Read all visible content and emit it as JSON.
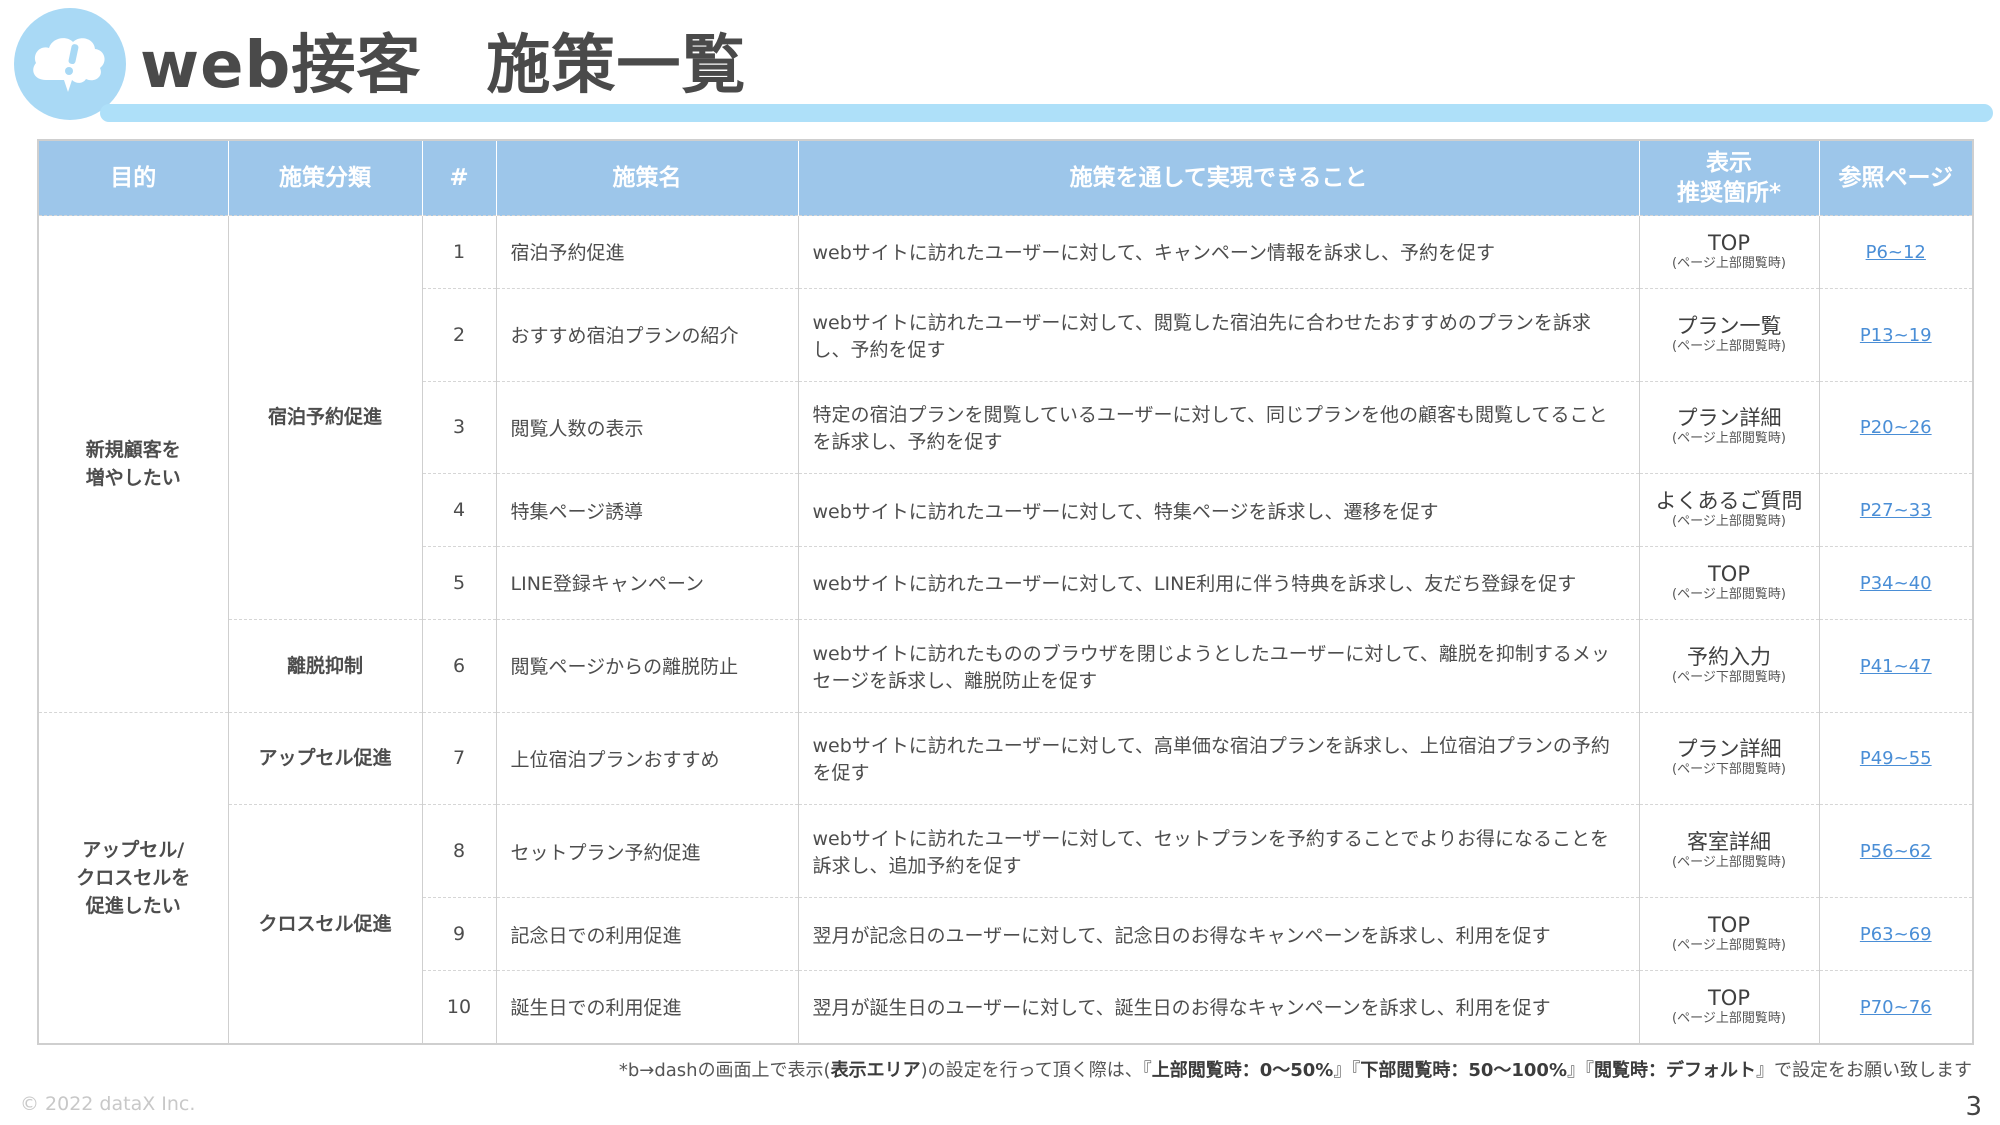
{
  "header": {
    "title": "web接客　施策一覧"
  },
  "table": {
    "columns": [
      "目的",
      "施策分類",
      "#",
      "施策名",
      "施策を通して実現できること",
      "表示\n推奨箇所*",
      "参照ページ"
    ],
    "objectives": [
      "新規顧客を\n増やしたい",
      "アップセル/\nクロスセルを\n促進したい"
    ],
    "categories": [
      "宿泊予約促進",
      "離脱抑制",
      "アップセル促進",
      "クロスセル促進"
    ],
    "rows": [
      {
        "num": "1",
        "name": "宿泊予約促進",
        "desc": "webサイトに訪れたユーザーに対して、キャンペーン情報を訴求し、予約を促す",
        "area": "TOP",
        "area_sub": "(ページ上部閲覧時)",
        "ref": "P6~12"
      },
      {
        "num": "2",
        "name": "おすすめ宿泊プランの紹介",
        "desc": "webサイトに訪れたユーザーに対して、閲覧した宿泊先に合わせたおすすめのプランを訴求し、予約を促す",
        "area": "プラン一覧",
        "area_sub": "(ページ上部閲覧時)",
        "ref": "P13~19"
      },
      {
        "num": "3",
        "name": "閲覧人数の表示",
        "desc": "特定の宿泊プランを閲覧しているユーザーに対して、同じプランを他の顧客も閲覧してることを訴求し、予約を促す",
        "area": "プラン詳細",
        "area_sub": "(ページ上部閲覧時)",
        "ref": "P20~26"
      },
      {
        "num": "4",
        "name": "特集ページ誘導",
        "desc": "webサイトに訪れたユーザーに対して、特集ページを訴求し、遷移を促す",
        "area": "よくあるご質問",
        "area_sub": "(ページ上部閲覧時)",
        "ref": "P27~33"
      },
      {
        "num": "5",
        "name": "LINE登録キャンペーン",
        "desc": "webサイトに訪れたユーザーに対して、LINE利用に伴う特典を訴求し、友だち登録を促す",
        "area": "TOP",
        "area_sub": "(ページ上部閲覧時)",
        "ref": "P34~40"
      },
      {
        "num": "6",
        "name": "閲覧ページからの離脱防止",
        "desc": "webサイトに訪れたもののブラウザを閉じようとしたユーザーに対して、離脱を抑制するメッセージを訴求し、離脱防止を促す",
        "area": "予約入力",
        "area_sub": "(ページ下部閲覧時)",
        "ref": "P41~47"
      },
      {
        "num": "7",
        "name": "上位宿泊プランおすすめ",
        "desc": "webサイトに訪れたユーザーに対して、高単価な宿泊プランを訴求し、上位宿泊プランの予約を促す",
        "area": "プラン詳細",
        "area_sub": "(ページ下部閲覧時)",
        "ref": "P49~55"
      },
      {
        "num": "8",
        "name": "セットプラン予約促進",
        "desc": "webサイトに訪れたユーザーに対して、セットプランを予約することでよりお得になることを訴求し、追加予約を促す",
        "area": "客室詳細",
        "area_sub": "(ページ上部閲覧時)",
        "ref": "P56~62"
      },
      {
        "num": "9",
        "name": "記念日での利用促進",
        "desc": "翌月が記念日のユーザーに対して、記念日のお得なキャンペーンを訴求し、利用を促す",
        "area": "TOP",
        "area_sub": "(ページ上部閲覧時)",
        "ref": "P63~69"
      },
      {
        "num": "10",
        "name": "誕生日での利用促進",
        "desc": "翌月が誕生日のユーザーに対して、誕生日のお得なキャンペーンを訴求し、利用を促す",
        "area": "TOP",
        "area_sub": "(ページ上部閲覧時)",
        "ref": "P70~76"
      }
    ]
  },
  "footnote": {
    "prefix": "*b→dashの画面上で表示(",
    "bold1": "表示エリア",
    "mid1": ")の設定を行って頂く際は、『",
    "bold2": "上部閲覧時：0〜50%",
    "mid2": "』『",
    "bold3": "下部閲覧時：50〜100%",
    "mid3": "』『",
    "bold4": "閲覧時：デフォルト",
    "suffix": "』で設定をお願い致します"
  },
  "footer": {
    "copyright": "© 2022 dataX Inc.",
    "page_number": "3"
  },
  "colors": {
    "header_bg": "#9dc6ea",
    "accent_bar": "#aee0f9",
    "link": "#4a8ed6"
  },
  "icons": {
    "logo": "cloud-exclamation-icon"
  }
}
